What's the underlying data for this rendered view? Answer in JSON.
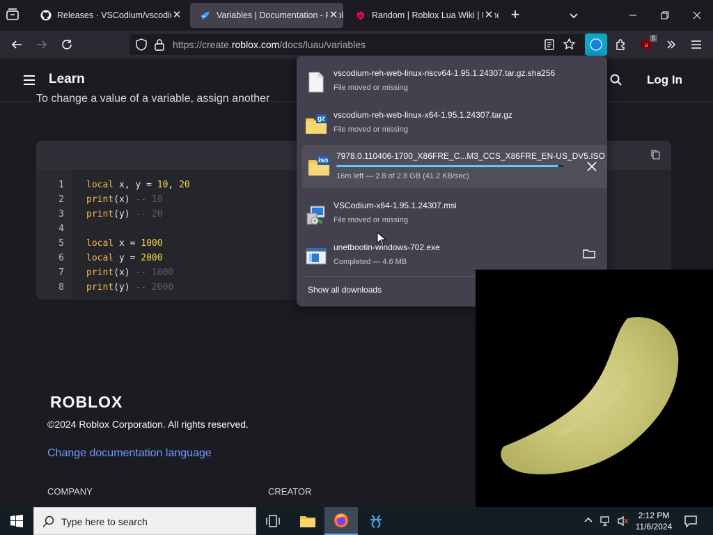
{
  "tabs": [
    {
      "title": "Releases · VSCodium/vscodium",
      "active": false
    },
    {
      "title": "Variables | Documentation - Roblox",
      "active": true
    },
    {
      "title": "Random | Roblox Lua Wiki | Fandom",
      "active": false
    }
  ],
  "tab_close_glyph": "✕",
  "new_tab_glyph": "+",
  "url": {
    "prefix": "https://create.",
    "domain": "roblox.com",
    "path": "/docs/luau/variables"
  },
  "extension_badge": "5",
  "page": {
    "header_title": "Learn",
    "login_label": "Log In",
    "partial_text": "To change a value of a variable, assign another",
    "code_lines": [
      {
        "n": "1",
        "parts": [
          [
            "kw",
            "local"
          ],
          [
            "",
            "x, y = "
          ],
          [
            "num",
            "10"
          ],
          [
            "",
            ", "
          ],
          [
            "num",
            "20"
          ]
        ]
      },
      {
        "n": "2",
        "parts": [
          [
            "kw",
            "print"
          ],
          [
            "",
            "(x) "
          ],
          [
            "cm",
            "-- 10"
          ]
        ]
      },
      {
        "n": "3",
        "parts": [
          [
            "kw",
            "print"
          ],
          [
            "",
            "(y) "
          ],
          [
            "cm",
            "-- 20"
          ]
        ]
      },
      {
        "n": "4",
        "parts": []
      },
      {
        "n": "5",
        "parts": [
          [
            "kw",
            "local"
          ],
          [
            "",
            "x = "
          ],
          [
            "num",
            "1000"
          ]
        ]
      },
      {
        "n": "6",
        "parts": [
          [
            "kw",
            "local"
          ],
          [
            "",
            "y = "
          ],
          [
            "num",
            "2000"
          ]
        ]
      },
      {
        "n": "7",
        "parts": [
          [
            "kw",
            "print"
          ],
          [
            "",
            "(x) "
          ],
          [
            "cm",
            "-- 1000"
          ]
        ]
      },
      {
        "n": "8",
        "parts": [
          [
            "kw",
            "print"
          ],
          [
            "",
            "(y) "
          ],
          [
            "cm",
            "-- 2000"
          ]
        ]
      }
    ],
    "footer": {
      "logo": "ROBLOX",
      "copyright": "©2024 Roblox Corporation. All rights reserved.",
      "language_link": "Change documentation language",
      "col1": "COMPANY",
      "col2": "CREATOR"
    }
  },
  "downloads": {
    "items": [
      {
        "name": "vscodium-reh-web-linux-riscv64-1.95.1.24307.tar.gz.sha256",
        "status": "File moved or missing",
        "icon": "text-file-icon"
      },
      {
        "name": "vscodium-reh-web-linux-x64-1.95.1.24307.tar.gz",
        "status": "File moved or missing",
        "icon": "gz-archive-icon",
        "icon_tag": "gz"
      },
      {
        "name": "7978.0.110406-1700_X86FRE_C...M3_CCS_X86FRE_EN-US_DV5.ISO",
        "status": "16m left — 2.8 of 2.8 GB (41.2 KB/sec)",
        "icon": "iso-file-icon",
        "icon_tag": "iso",
        "progress": 0.98,
        "action": "cancel-icon"
      },
      {
        "name": "VSCodium-x64-1.95.1.24307.msi",
        "status": "File moved or missing",
        "icon": "msi-installer-icon"
      },
      {
        "name": "unetbootin-windows-702.exe",
        "status": "Completed — 4.6 MB",
        "icon": "exe-app-icon",
        "action": "folder-icon"
      }
    ],
    "show_all": "Show all downloads"
  },
  "taskbar": {
    "search_placeholder": "Type here to search",
    "time": "2:12 PM",
    "date": "11/6/2024"
  },
  "colors": {
    "link": "#6b9cff",
    "progress": "#0df"
  }
}
